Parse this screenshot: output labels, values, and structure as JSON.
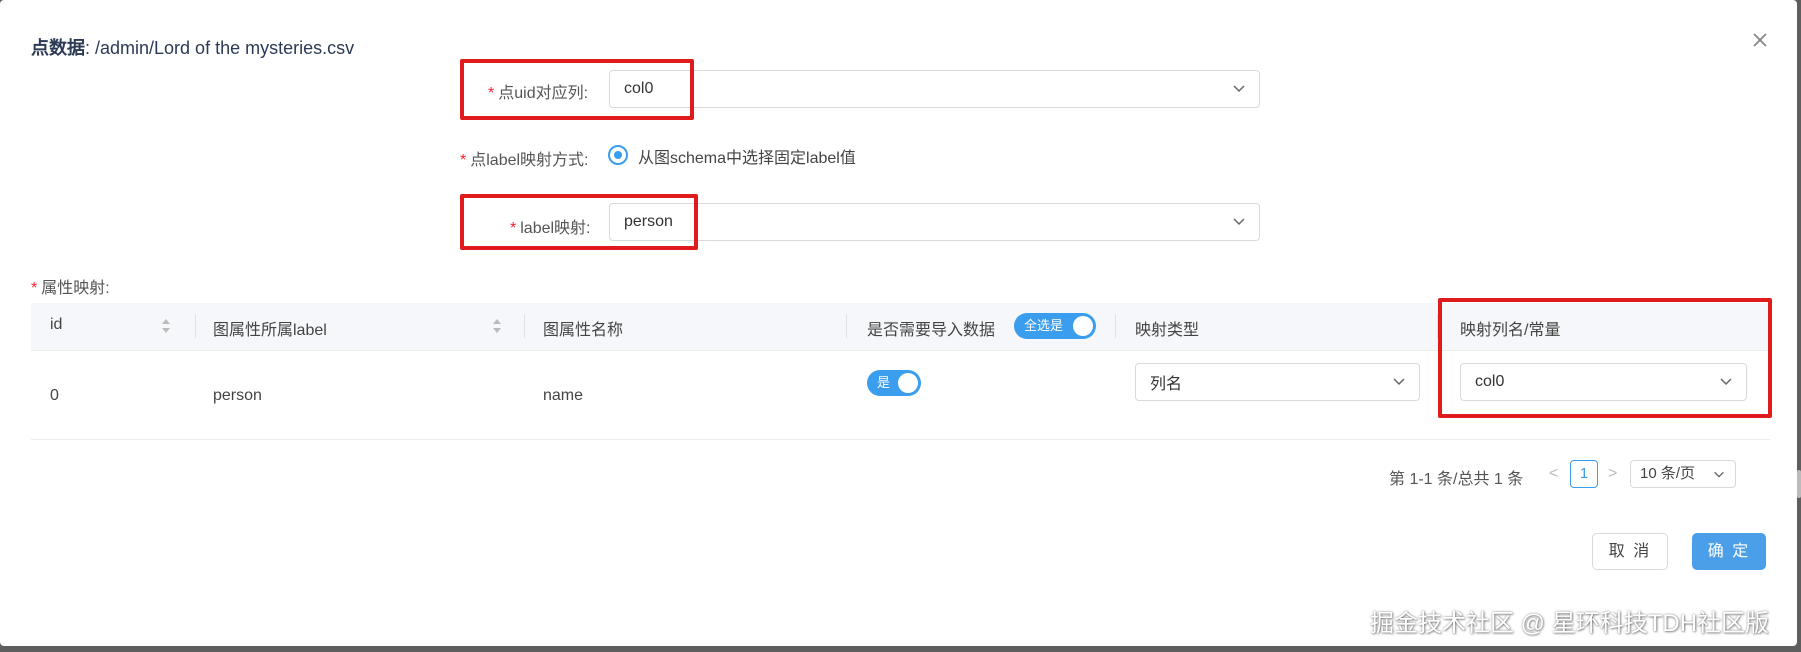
{
  "dialog": {
    "title_label": "点数据",
    "title_path": ": /admin/Lord of the mysteries.csv",
    "close_icon": "close-icon"
  },
  "form": {
    "required_mark": "*",
    "uid_label": "点uid对应列:",
    "uid_value": "col0",
    "label_mode_label": "点label映射方式:",
    "label_mode_option": "从图schema中选择固定label值",
    "label_map_label": "label映射:",
    "label_map_value": "person",
    "attr_section_label": "属性映射:"
  },
  "table": {
    "headers": {
      "id": "id",
      "graph_label": "图属性所属label",
      "attr_name": "图属性名称",
      "import": "是否需要导入数据",
      "import_toggle": "全选是",
      "map_type": "映射类型",
      "map_column": "映射列名/常量"
    },
    "rows": [
      {
        "id": "0",
        "graph_label": "person",
        "attr_name": "name",
        "import_toggle": "是",
        "map_type": "列名",
        "map_column": "col0"
      }
    ]
  },
  "pagination": {
    "summary": "第 1-1 条/总共 1 条",
    "prev": "<",
    "next": ">",
    "current_page": "1",
    "page_size": "10 条/页"
  },
  "footer": {
    "cancel_label": "取 消",
    "ok_label": "确 定"
  },
  "watermark": "掘金技术社区 @ 星环科技TDH社区版",
  "colors": {
    "accent": "#3b9dee",
    "required": "#f5222d",
    "highlight_box": "#e01b1b"
  }
}
